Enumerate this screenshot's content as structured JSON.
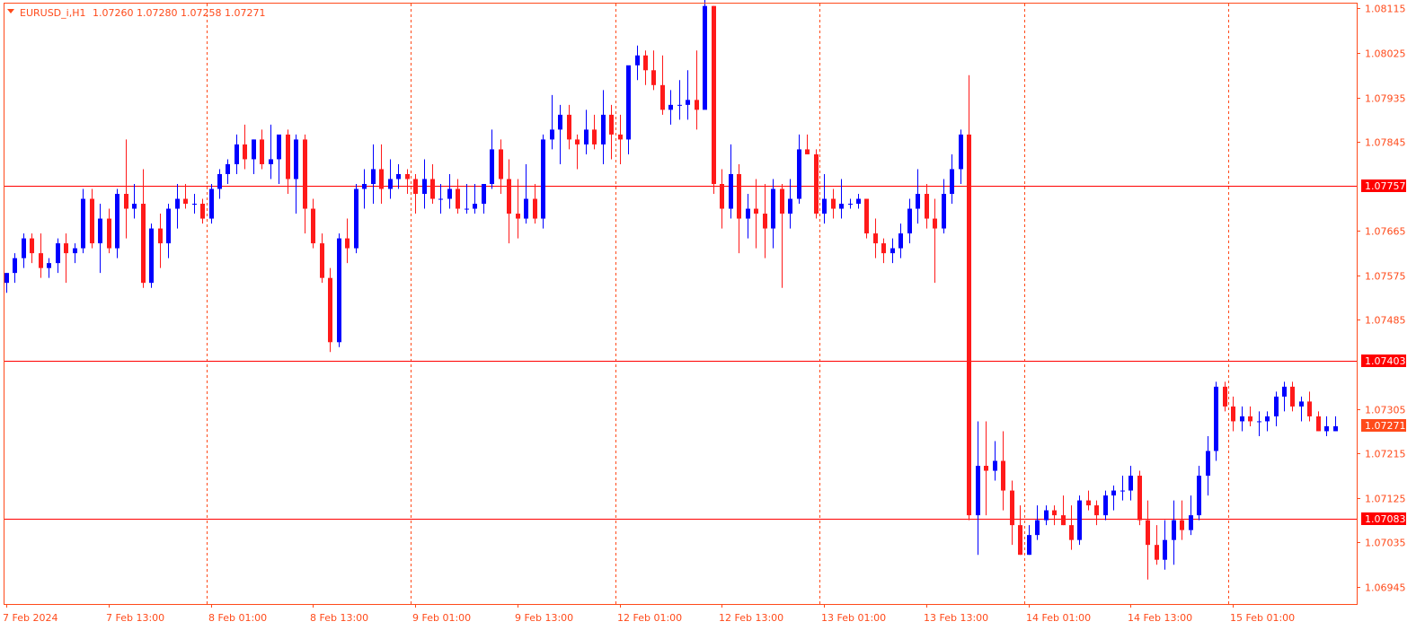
{
  "header": {
    "symbol_label": "EURUSD_i,H1",
    "ohlc_text": "1.07260 1.07280 1.07258 1.07271"
  },
  "colors": {
    "background": "#ffffff",
    "frame": "#ff4a1a",
    "grid": "#ff4a1a",
    "axis_text": "#ff4a1a",
    "bull_candle": "#0000ff",
    "bear_candle": "#ff1a1a",
    "level_line": "#ff0000",
    "price_tag": "#ff0000",
    "current_price_tag": "#ff4a1a",
    "tag_text": "#ffffff"
  },
  "chart_data": {
    "type": "candlestick",
    "timeframe": "H1",
    "grid": "vertical dashed",
    "y_axis": {
      "ticks": [
        1.08115,
        1.08025,
        1.07935,
        1.07845,
        1.07665,
        1.07575,
        1.07485,
        1.07305,
        1.07215,
        1.07125,
        1.07035,
        1.06945
      ],
      "ylim": [
        1.06925,
        1.0815
      ]
    },
    "x_axis": {
      "tick_labels": [
        "7 Feb 2024",
        "7 Feb 13:00",
        "8 Feb 01:00",
        "8 Feb 13:00",
        "9 Feb 01:00",
        "9 Feb 13:00",
        "12 Feb 01:00",
        "12 Feb 13:00",
        "13 Feb 01:00",
        "13 Feb 13:00",
        "14 Feb 01:00",
        "14 Feb 13:00",
        "15 Feb 01:00"
      ],
      "tick_bars": [
        0,
        12,
        24,
        36,
        48,
        60,
        72,
        84,
        96,
        108,
        120,
        132,
        144
      ],
      "separator_bars": [
        23,
        47,
        71,
        95,
        119,
        143,
        167
      ]
    },
    "levels": [
      {
        "value": 1.07757,
        "label": "1.07757"
      },
      {
        "value": 1.07403,
        "label": "1.07403"
      },
      {
        "value": 1.07083,
        "label": "1.07083"
      }
    ],
    "current_price": {
      "value": 1.07271,
      "label": "1.07271"
    },
    "candles": [
      [
        1.0756,
        1.0758,
        1.0754,
        1.0758
      ],
      [
        1.0758,
        1.0762,
        1.0756,
        1.0761
      ],
      [
        1.0761,
        1.0766,
        1.0759,
        1.0765
      ],
      [
        1.0765,
        1.0766,
        1.076,
        1.0762
      ],
      [
        1.0762,
        1.0766,
        1.0757,
        1.0759
      ],
      [
        1.0759,
        1.0761,
        1.0757,
        1.076
      ],
      [
        1.076,
        1.0765,
        1.0758,
        1.0764
      ],
      [
        1.0764,
        1.0766,
        1.0756,
        1.0762
      ],
      [
        1.0762,
        1.0764,
        1.076,
        1.0763
      ],
      [
        1.0763,
        1.0775,
        1.0762,
        1.0773
      ],
      [
        1.0773,
        1.0775,
        1.0763,
        1.0764
      ],
      [
        1.0764,
        1.0772,
        1.0758,
        1.0769
      ],
      [
        1.0769,
        1.0771,
        1.0762,
        1.0763
      ],
      [
        1.0763,
        1.0775,
        1.0761,
        1.0774
      ],
      [
        1.0774,
        1.0785,
        1.0765,
        1.0771
      ],
      [
        1.0771,
        1.0776,
        1.0769,
        1.0772
      ],
      [
        1.0772,
        1.0779,
        1.0755,
        1.0756
      ],
      [
        1.0756,
        1.0768,
        1.0755,
        1.0767
      ],
      [
        1.0767,
        1.077,
        1.0759,
        1.0764
      ],
      [
        1.0764,
        1.0772,
        1.0761,
        1.0771
      ],
      [
        1.0771,
        1.0776,
        1.0767,
        1.0773
      ],
      [
        1.0773,
        1.0776,
        1.0771,
        1.0772
      ],
      [
        1.0772,
        1.0774,
        1.077,
        1.0772
      ],
      [
        1.0772,
        1.0773,
        1.0768,
        1.0769
      ],
      [
        1.0769,
        1.0776,
        1.0768,
        1.0775
      ],
      [
        1.0775,
        1.0779,
        1.0773,
        1.0778
      ],
      [
        1.0778,
        1.0781,
        1.0776,
        1.078
      ],
      [
        1.078,
        1.0786,
        1.0778,
        1.0784
      ],
      [
        1.0784,
        1.0788,
        1.0779,
        1.0781
      ],
      [
        1.0781,
        1.0785,
        1.0778,
        1.0785
      ],
      [
        1.0785,
        1.0787,
        1.0779,
        1.078
      ],
      [
        1.078,
        1.0788,
        1.0777,
        1.0781
      ],
      [
        1.0781,
        1.0784,
        1.0776,
        1.0786
      ],
      [
        1.0786,
        1.0787,
        1.0774,
        1.0777
      ],
      [
        1.0777,
        1.0786,
        1.077,
        1.0785
      ],
      [
        1.0785,
        1.0786,
        1.0766,
        1.0771
      ],
      [
        1.0771,
        1.0773,
        1.0763,
        1.0764
      ],
      [
        1.0764,
        1.0766,
        1.0756,
        1.0757
      ],
      [
        1.0757,
        1.0759,
        1.0742,
        1.0744
      ],
      [
        1.0744,
        1.0766,
        1.0743,
        1.0765
      ],
      [
        1.0765,
        1.0769,
        1.076,
        1.0763
      ],
      [
        1.0763,
        1.0776,
        1.0762,
        1.0775
      ],
      [
        1.0775,
        1.0779,
        1.0771,
        1.0776
      ],
      [
        1.0776,
        1.0784,
        1.0772,
        1.0779
      ],
      [
        1.0779,
        1.0784,
        1.0772,
        1.0775
      ],
      [
        1.0775,
        1.0781,
        1.0773,
        1.0777
      ],
      [
        1.0777,
        1.078,
        1.0775,
        1.0778
      ],
      [
        1.0778,
        1.0779,
        1.0774,
        1.0777
      ],
      [
        1.0777,
        1.0778,
        1.077,
        1.0774
      ],
      [
        1.0774,
        1.0781,
        1.0771,
        1.0777
      ],
      [
        1.0777,
        1.078,
        1.0772,
        1.0773
      ],
      [
        1.0773,
        1.0776,
        1.077,
        1.0773
      ],
      [
        1.0773,
        1.0778,
        1.0771,
        1.0775
      ],
      [
        1.0775,
        1.0777,
        1.077,
        1.0771
      ],
      [
        1.0771,
        1.0776,
        1.077,
        1.0771
      ],
      [
        1.0771,
        1.0776,
        1.077,
        1.0772
      ],
      [
        1.0772,
        1.0776,
        1.077,
        1.0776
      ],
      [
        1.0776,
        1.0787,
        1.0775,
        1.0783
      ],
      [
        1.0783,
        1.0785,
        1.0774,
        1.0777
      ],
      [
        1.0777,
        1.0781,
        1.0764,
        1.077
      ],
      [
        1.077,
        1.0777,
        1.0765,
        1.0769
      ],
      [
        1.0769,
        1.078,
        1.0768,
        1.0773
      ],
      [
        1.0773,
        1.0776,
        1.0768,
        1.0769
      ],
      [
        1.0769,
        1.0786,
        1.0767,
        1.0785
      ],
      [
        1.0785,
        1.0794,
        1.0783,
        1.0787
      ],
      [
        1.0787,
        1.0792,
        1.078,
        1.079
      ],
      [
        1.079,
        1.0792,
        1.0783,
        1.0785
      ],
      [
        1.0785,
        1.0786,
        1.0779,
        1.0784
      ],
      [
        1.0784,
        1.0791,
        1.0782,
        1.0787
      ],
      [
        1.0787,
        1.079,
        1.0783,
        1.0784
      ],
      [
        1.0784,
        1.0795,
        1.078,
        1.079
      ],
      [
        1.079,
        1.0792,
        1.0781,
        1.0786
      ],
      [
        1.0786,
        1.079,
        1.078,
        1.0785
      ],
      [
        1.0785,
        1.0799,
        1.0782,
        1.08
      ],
      [
        1.08,
        1.0804,
        1.0797,
        1.0802
      ],
      [
        1.0802,
        1.0803,
        1.0796,
        1.0799
      ],
      [
        1.0799,
        1.0803,
        1.0795,
        1.0796
      ],
      [
        1.0796,
        1.0802,
        1.079,
        1.0791
      ],
      [
        1.0791,
        1.0795,
        1.0788,
        1.0792
      ],
      [
        1.0792,
        1.0797,
        1.0789,
        1.0792
      ],
      [
        1.0792,
        1.0799,
        1.0789,
        1.0793
      ],
      [
        1.0793,
        1.0803,
        1.0787,
        1.0791
      ],
      [
        1.0791,
        1.0814,
        1.0792,
        1.0812
      ],
      [
        1.0812,
        1.0812,
        1.0774,
        1.0776
      ],
      [
        1.0776,
        1.0779,
        1.0767,
        1.0771
      ],
      [
        1.0771,
        1.0784,
        1.0769,
        1.0778
      ],
      [
        1.0778,
        1.078,
        1.0762,
        1.0769
      ],
      [
        1.0769,
        1.0774,
        1.0765,
        1.0771
      ],
      [
        1.0771,
        1.0777,
        1.0763,
        1.077
      ],
      [
        1.077,
        1.0776,
        1.0761,
        1.0767
      ],
      [
        1.0767,
        1.0777,
        1.0763,
        1.0775
      ],
      [
        1.0775,
        1.0776,
        1.0755,
        1.077
      ],
      [
        1.077,
        1.0777,
        1.0767,
        1.0773
      ],
      [
        1.0773,
        1.0786,
        1.0772,
        1.0783
      ],
      [
        1.0783,
        1.0786,
        1.0782,
        1.0782
      ],
      [
        1.0782,
        1.0783,
        1.0769,
        1.077
      ],
      [
        1.077,
        1.0778,
        1.0768,
        1.0773
      ],
      [
        1.0773,
        1.0775,
        1.0769,
        1.0771
      ],
      [
        1.0771,
        1.0777,
        1.0769,
        1.0772
      ],
      [
        1.0772,
        1.0773,
        1.0771,
        1.0772
      ],
      [
        1.0772,
        1.0774,
        1.0771,
        1.0773
      ],
      [
        1.0773,
        1.0773,
        1.0765,
        1.0766
      ],
      [
        1.0766,
        1.0769,
        1.0761,
        1.0764
      ],
      [
        1.0764,
        1.0765,
        1.076,
        1.0762
      ],
      [
        1.0762,
        1.0765,
        1.076,
        1.0763
      ],
      [
        1.0763,
        1.0768,
        1.0761,
        1.0766
      ],
      [
        1.0766,
        1.0773,
        1.0764,
        1.0771
      ],
      [
        1.0771,
        1.0779,
        1.0768,
        1.0774
      ],
      [
        1.0774,
        1.0776,
        1.0767,
        1.0769
      ],
      [
        1.0769,
        1.0773,
        1.0756,
        1.0767
      ],
      [
        1.0767,
        1.0777,
        1.0766,
        1.0774
      ],
      [
        1.0774,
        1.0782,
        1.0772,
        1.0779
      ],
      [
        1.0779,
        1.0787,
        1.0776,
        1.0786
      ],
      [
        1.0786,
        1.0798,
        1.0708,
        1.0709
      ],
      [
        1.0709,
        1.0728,
        1.0701,
        1.0719
      ],
      [
        1.0719,
        1.0728,
        1.0709,
        1.0718
      ],
      [
        1.0718,
        1.0724,
        1.0716,
        1.072
      ],
      [
        1.072,
        1.0726,
        1.071,
        1.0714
      ],
      [
        1.0714,
        1.0716,
        1.0703,
        1.0707
      ],
      [
        1.0707,
        1.0711,
        1.0701,
        1.0701
      ],
      [
        1.0701,
        1.0707,
        1.0701,
        1.0705
      ],
      [
        1.0705,
        1.0711,
        1.0704,
        1.0708
      ],
      [
        1.0708,
        1.0711,
        1.0707,
        1.071
      ],
      [
        1.071,
        1.0711,
        1.0707,
        1.0709
      ],
      [
        1.0709,
        1.0713,
        1.0707,
        1.0707
      ],
      [
        1.0707,
        1.0711,
        1.0702,
        1.0704
      ],
      [
        1.0704,
        1.0713,
        1.0703,
        1.0712
      ],
      [
        1.0712,
        1.0714,
        1.071,
        1.0711
      ],
      [
        1.0711,
        1.0712,
        1.0707,
        1.0709
      ],
      [
        1.0709,
        1.0714,
        1.0708,
        1.0713
      ],
      [
        1.0713,
        1.0715,
        1.071,
        1.0714
      ],
      [
        1.0714,
        1.0717,
        1.0712,
        1.0714
      ],
      [
        1.0714,
        1.0719,
        1.0712,
        1.0717
      ],
      [
        1.0717,
        1.0718,
        1.0707,
        1.0708
      ],
      [
        1.0708,
        1.0712,
        1.0696,
        1.0703
      ],
      [
        1.0703,
        1.0707,
        1.0699,
        1.07
      ],
      [
        1.07,
        1.0708,
        1.0698,
        1.0704
      ],
      [
        1.0704,
        1.0712,
        1.0699,
        1.0708
      ],
      [
        1.0708,
        1.0712,
        1.0704,
        1.0706
      ],
      [
        1.0706,
        1.0713,
        1.0705,
        1.0709
      ],
      [
        1.0709,
        1.0719,
        1.0708,
        1.0717
      ],
      [
        1.0717,
        1.0725,
        1.0713,
        1.0722
      ],
      [
        1.0722,
        1.0736,
        1.072,
        1.0735
      ],
      [
        1.0735,
        1.0736,
        1.073,
        1.0731
      ],
      [
        1.0731,
        1.0733,
        1.0726,
        1.0728
      ],
      [
        1.0728,
        1.0731,
        1.0726,
        1.0729
      ],
      [
        1.0729,
        1.0731,
        1.0727,
        1.0728
      ],
      [
        1.0728,
        1.073,
        1.0725,
        1.0728
      ],
      [
        1.0728,
        1.073,
        1.0726,
        1.0729
      ],
      [
        1.0729,
        1.0734,
        1.0727,
        1.0733
      ],
      [
        1.0733,
        1.0736,
        1.073,
        1.0735
      ],
      [
        1.0735,
        1.0736,
        1.073,
        1.0731
      ],
      [
        1.0731,
        1.0733,
        1.0728,
        1.0732
      ],
      [
        1.0732,
        1.0734,
        1.0728,
        1.0729
      ],
      [
        1.0729,
        1.073,
        1.0726,
        1.0726
      ],
      [
        1.0726,
        1.0729,
        1.0725,
        1.0727
      ],
      [
        1.0726,
        1.0729,
        1.0726,
        1.0727
      ]
    ]
  }
}
